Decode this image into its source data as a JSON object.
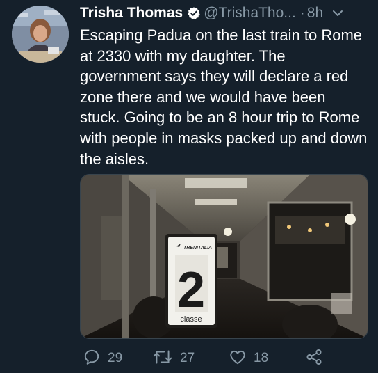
{
  "tweet": {
    "author_name": "Trisha Thomas",
    "handle": "@TrishaTho...",
    "separator": "·",
    "timestamp": "8h",
    "text": "Escaping Padua on the last train to Rome at 2330 with my daughter. The government says they will declare a red zone there and we would have been stuck. Going to be an 8 hour trip to Rome with people in masks packed up and down the aisles.",
    "media": {
      "sign_brand": "TRENITALIA",
      "sign_number": "2",
      "sign_caption": "classe"
    },
    "actions": {
      "reply_count": "29",
      "retweet_count": "27",
      "like_count": "18"
    }
  },
  "icons": {
    "verified": "verified-badge-icon",
    "more": "chevron-down-icon",
    "reply": "reply-icon",
    "retweet": "retweet-icon",
    "like": "heart-icon",
    "share": "share-icon"
  },
  "colors": {
    "background": "#15202b",
    "text": "#ffffff",
    "muted": "#8899a6"
  }
}
